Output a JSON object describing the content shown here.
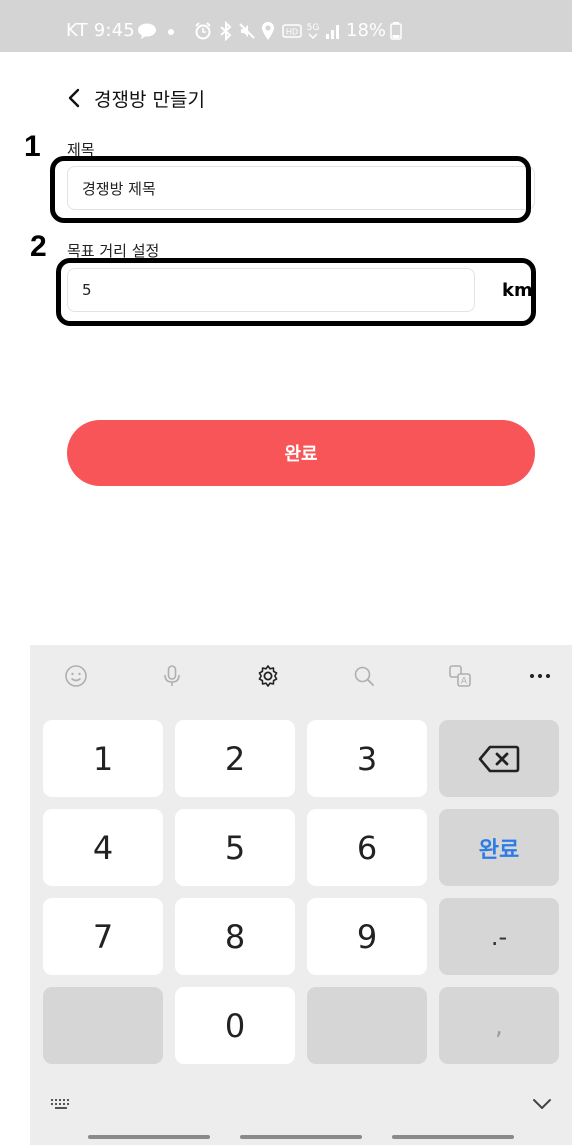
{
  "status_bar": {
    "carrier_time": "KT 9:45",
    "icons": [
      "talk-icon",
      "dot-icon",
      "alarm-icon",
      "bluetooth-icon",
      "mute-icon",
      "location-icon",
      "hd-icon",
      "5g-icon",
      "signal-icon"
    ],
    "battery_text": "18%"
  },
  "header": {
    "title": "경쟁방 만들기"
  },
  "annotations": [
    "1",
    "2"
  ],
  "form": {
    "title_label": "제목",
    "title_value": "경쟁방 제목",
    "distance_label": "목표 거리 설정",
    "distance_value": "5",
    "distance_unit": "km"
  },
  "submit_label": "완료",
  "keyboard": {
    "toolbar": [
      "emoji-icon",
      "mic-icon",
      "settings-icon",
      "search-icon",
      "translate-icon",
      "more-icon"
    ],
    "keys": {
      "k1": "1",
      "k2": "2",
      "k3": "3",
      "k4": "4",
      "k5": "5",
      "k6": "6",
      "k7": "7",
      "k8": "8",
      "k9": "9",
      "k0": "0",
      "done": "완료",
      "dot_minus": ".-",
      "comma": ","
    }
  },
  "colors": {
    "accent": "#f85559",
    "keyboard_bg": "#ededed",
    "done_key_text": "#2d7be5",
    "status_bar_bg": "#d4d4d4"
  }
}
